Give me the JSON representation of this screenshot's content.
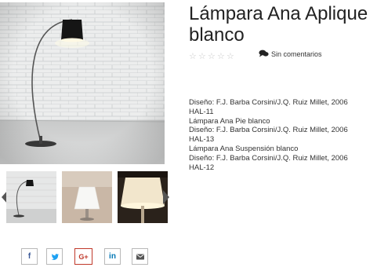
{
  "product": {
    "title_line1": "Lámpara Ana Aplique",
    "title_line2": "blanco",
    "rating_stars": 5,
    "rating_value": 0,
    "comments_label": "Sin comentarios"
  },
  "description": {
    "lines": [
      "Diseño: F.J. Barba Corsini/J.Q. Ruiz Millet, 2006",
      "HAL-11",
      "Lámpara Ana Pie blanco",
      "Diseño: F.J. Barba Corsini/J.Q. Ruiz Millet, 2006",
      "HAL-13",
      "Lámpara Ana Suspensión blanco",
      "Diseño: F.J. Barba Corsini/J.Q. Ruiz Millet, 2006",
      "HAL-12"
    ]
  },
  "gallery": {
    "thumbnails": [
      "arc-lamp-thumbnail",
      "table-lamp-thumbnail",
      "floor-lamp-thumbnail"
    ]
  },
  "share": {
    "facebook": "f",
    "twitter": "twitter-icon",
    "googleplus": "G+",
    "linkedin": "in",
    "email": "email-icon"
  },
  "colors": {
    "title": "#222222",
    "star_empty": "#c8c8c8",
    "googleplus_border": "#c0392b",
    "facebook": "#3b5998",
    "twitter": "#1da1f2",
    "linkedin": "#0077b5"
  }
}
